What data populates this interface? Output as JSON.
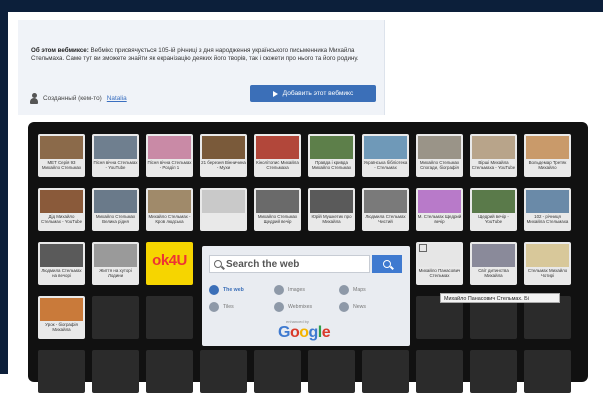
{
  "info": {
    "heading": "Об этом вебмиксе:",
    "description": "Вебмікс присвячується 105-ій річниці з дня народження українського письменника Михайла Стельмаха. Саме тут ви зможете знайти як екранізацію деяких його творів, так і сюжети про нього та його родину.",
    "creator_label": "Созданный (кем-то)",
    "creator_link": "Natalia",
    "add_button": "Добавить этот вебмикс"
  },
  "tiles": [
    {
      "caption": "МЕТ Серія 93 Михайло Стельмах",
      "color": "#8b6a4a"
    },
    {
      "caption": "Пісня вічна Стельмах - YouTube",
      "color": "#6f7f8f"
    },
    {
      "caption": "Пісня вічна Стельмах - Розділ 1",
      "color": "#c98aa6"
    },
    {
      "caption": "21 березня Вінничина - Мухи",
      "color": "#7a5a3a"
    },
    {
      "caption": "Кінолітопис Михайла Стельмаха",
      "color": "#b2473a"
    },
    {
      "caption": "Правда і кривда Михайло Стельмах",
      "color": "#5d7f4a"
    },
    {
      "caption": "Українська бібліотека - Стельмах",
      "color": "#6f99b8"
    },
    {
      "caption": "Михайло Стельмах Спогади, біографія",
      "color": "#9a9488"
    },
    {
      "caption": "Вірші Михайла Стельмаха - YouTube",
      "color": "#b8a48a"
    },
    {
      "caption": "Вольдемар Третяк Михайло",
      "color": "#c99a6a"
    },
    {
      "caption": "Дід Михайло Стельмах - YouTube",
      "color": "#8a5a3a"
    },
    {
      "caption": "Михайло Стельмах Велика рідня",
      "color": "#6a7a8a"
    },
    {
      "caption": "Михайло Стельмах - Кров людська",
      "color": "#a08a6a"
    },
    {
      "caption": "",
      "color": "#c9c9c9"
    },
    {
      "caption": "Михайло Стельмах Щедрий вечір",
      "color": "#6a6a6a"
    },
    {
      "caption": "Юрій Мушкетик про Михайла",
      "color": "#5a5a5a"
    },
    {
      "caption": "Людмила Стельмах Чистий",
      "color": "#7a7a7a"
    },
    {
      "caption": "М. Стельмах Щедрий вечір",
      "color": "#b87ac9"
    },
    {
      "caption": "Щедрий вечір - YouTube",
      "color": "#5a7a4a"
    },
    {
      "caption": "102 - річниця Михайла Стельмаха",
      "color": "#6a8aa8"
    },
    {
      "caption": "Людмила Стельмах на вечорі",
      "color": "#5a5a5a"
    },
    {
      "caption": "Життя на хуторі Лодини",
      "color": "#9a9a9a"
    },
    {
      "caption": "Михайло Панасович Стельмах",
      "color": "#e6e6e6"
    },
    {
      "caption": "Світ дитинства Михайла",
      "color": "#8a8a9a"
    },
    {
      "caption": "Стельмах Михайло Чотирі",
      "color": "#d8c89a"
    },
    {
      "caption": "Урок - біографія Михайла",
      "color": "#c97a3a"
    }
  ],
  "kt_logo": "ok4U",
  "search": {
    "placeholder": "Search the web",
    "options": [
      {
        "label": "The web",
        "icon": "globe-icon"
      },
      {
        "label": "Images",
        "icon": "camera-icon"
      },
      {
        "label": "Maps",
        "icon": "pin-icon"
      },
      {
        "label": "Tiles",
        "icon": "edit-icon"
      },
      {
        "label": "Webmixes",
        "icon": "grid-icon"
      },
      {
        "label": "News",
        "icon": "news-icon"
      }
    ],
    "enhanced_by": "enhanced by",
    "logo_text": "Google"
  },
  "tooltip": "Михайло Панасович Стельмах. Бі",
  "colors": {
    "brand_dark": "#0c1f3a",
    "button_blue": "#3b6fb8",
    "board_bg": "#111111"
  }
}
